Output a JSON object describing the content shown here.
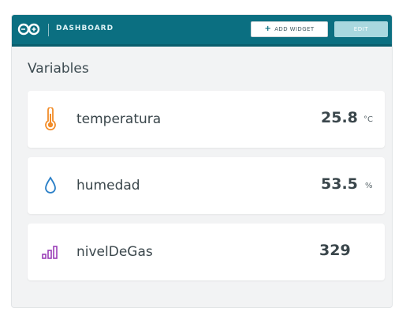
{
  "header": {
    "title": "DASHBOARD",
    "add_widget_label": "ADD WIDGET",
    "edit_label": "EDIT"
  },
  "section": {
    "title": "Variables"
  },
  "variables": [
    {
      "name": "temperatura",
      "value": "25.8",
      "unit": "°C",
      "icon": "thermometer-icon"
    },
    {
      "name": "humedad",
      "value": "53.5",
      "unit": "%",
      "icon": "water-drop-icon"
    },
    {
      "name": "nivelDeGas",
      "value": "329",
      "unit": "",
      "icon": "signal-bars-icon"
    }
  ],
  "colors": {
    "header_bg": "#0b6f81",
    "thermometer": "#f28c28",
    "water_drop": "#2a7fc7",
    "signal_bars": "#9b3fb8"
  }
}
